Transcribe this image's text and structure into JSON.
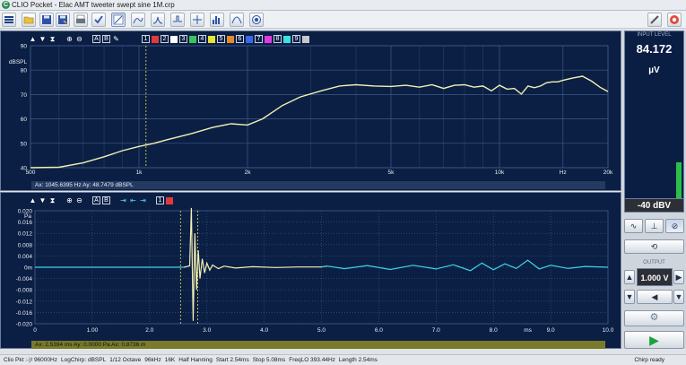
{
  "window": {
    "app_icon_letter": "C",
    "title": "CLIO Pocket - Elac AMT tweeter swept sine 1M.crp"
  },
  "toolbar": {
    "icons": [
      "menu-icon",
      "open-icon",
      "save-icon",
      "save-as-icon",
      "print-icon",
      "checkmark-icon",
      "frequency-response-icon",
      "waterfall-icon",
      "impedance-icon",
      "impulse-icon",
      "spectrum-icon",
      "thd-icon",
      "polar-icon",
      "ruler-icon",
      "help-lifebuoy-icon"
    ]
  },
  "colors": {
    "plot_bg": "#0b1f44",
    "grid": "#3f5a86",
    "grid_minor": "#24406b",
    "curve": "#f2f0b4",
    "impulse_tail": "#3fd3e6",
    "cursor": "#e7e34a",
    "axis_text": "#e8edf5"
  },
  "top_panel": {
    "toolbar": {
      "up": "▲",
      "down": "▼",
      "hourglass": "⧗",
      "zoom_in": "⊕",
      "zoom_out": "⊖",
      "btn_a": "A",
      "btn_b": "B",
      "overlays": [
        "1",
        "2",
        "3",
        "4",
        "5",
        "6",
        "7",
        "8",
        "9"
      ]
    },
    "overlay_colors": [
      "#e23a3a",
      "#ffffff",
      "#3ac45a",
      "#e8e23a",
      "#e88a2a",
      "#3a6ae8",
      "#e23ae2",
      "#3ae2e2",
      "#c8c8c8"
    ],
    "readout": "Ax: 1045.6395 Hz   Ay: 48.7479 dBSPL"
  },
  "bottom_panel": {
    "toolbar": {
      "up": "▲",
      "down": "▼",
      "hourglass": "⧗",
      "zoom_in": "⊕",
      "zoom_out": "⊖",
      "btn_a": "A",
      "btn_b": "B",
      "marker_1": "⇥",
      "marker_2": "⇤",
      "marker_3": "⇥",
      "overlays": [
        "1"
      ]
    },
    "readout": "Ax: 2.5394 ms   Ay: 0.0000 Pa   Ax: 0.8736 m"
  },
  "chart_data": [
    {
      "type": "line",
      "ylabel": "dBSPL",
      "xlabel": "Hz",
      "x_scale": "log",
      "xlim": [
        500,
        20000
      ],
      "ylim": [
        40,
        90
      ],
      "x_tick_labels": [
        "500",
        "1k",
        "2k",
        "5k",
        "10k",
        "Hz",
        "20k"
      ],
      "x_tick_values": [
        500,
        1000,
        2000,
        5000,
        10000,
        15000,
        20000
      ],
      "y_ticks": [
        40,
        50,
        60,
        70,
        80,
        90
      ],
      "cursor_x": 1045.6,
      "grid": true,
      "series": [
        {
          "x": [
            500,
            600,
            700,
            800,
            900,
            1000,
            1100,
            1200,
            1400,
            1600,
            1800,
            2000,
            2200,
            2500,
            2800,
            3200,
            3600,
            4000,
            4500,
            5000,
            5500,
            6000,
            6500,
            7000,
            7500,
            8000,
            8500,
            9000,
            9500,
            10000,
            10500,
            11000,
            11500,
            12000,
            12500,
            13000,
            13500,
            14000,
            14500,
            15000,
            16000,
            17000,
            18000,
            19000,
            20000
          ],
          "y": [
            40,
            40.2,
            42,
            44.5,
            47,
            48.7,
            50,
            51.5,
            54,
            56.5,
            58,
            57.5,
            60,
            65.5,
            69,
            71.5,
            73.5,
            74,
            73.5,
            73.3,
            73.8,
            73,
            74,
            72.5,
            73.8,
            74,
            73,
            73.5,
            71.5,
            73.8,
            72.2,
            72.5,
            70.2,
            73.5,
            72.8,
            73.5,
            74.8,
            75.2,
            75.2,
            75.8,
            76.8,
            77.5,
            75.5,
            73,
            71.2
          ]
        }
      ]
    },
    {
      "type": "line",
      "ylabel": "Pa",
      "xlabel": "ms",
      "xlim": [
        0,
        10
      ],
      "ylim": [
        -0.02,
        0.02
      ],
      "x_tick_labels": [
        "0",
        "1.00",
        "2.0",
        "3.0",
        "4.0",
        "5.0",
        "6.0",
        "7.0",
        "8.0",
        "9.0",
        "10.0"
      ],
      "x_tick_values": [
        0,
        1,
        2,
        3,
        4,
        5,
        6,
        7,
        8,
        9,
        10
      ],
      "y_tick_labels": [
        "0.020",
        "0.016",
        "0.012",
        "0.008",
        "0.004",
        "0m",
        "-0.004",
        "-0.008",
        "-0.012",
        "-0.016",
        "-0.020"
      ],
      "y_tick_values": [
        0.02,
        0.016,
        0.012,
        0.008,
        0.004,
        0,
        -0.004,
        -0.008,
        -0.012,
        -0.016,
        -0.02
      ],
      "cursor_x": [
        2.54,
        2.84
      ],
      "window_marks_ms": [
        2.54,
        5.08
      ],
      "grid": true,
      "series": [
        {
          "x": [
            0,
            2.6,
            2.7,
            2.73,
            2.76,
            2.79,
            2.82,
            2.85,
            2.88,
            2.92,
            2.96,
            3.0,
            3.05,
            3.1,
            3.2,
            3.3,
            3.5,
            3.8,
            4.2,
            4.6,
            5.0,
            5.1,
            5.4,
            5.8,
            6.2,
            6.6,
            7.0,
            7.3,
            7.6,
            7.8,
            8.0,
            8.2,
            8.4,
            8.6,
            8.8,
            9.0,
            9.3,
            9.6,
            10.0
          ],
          "y": [
            0,
            0,
            0.0005,
            0.021,
            -0.019,
            0.012,
            -0.008,
            0.006,
            -0.004,
            0.003,
            -0.002,
            0.0015,
            -0.001,
            0.0008,
            -0.0005,
            0.0004,
            -0.0003,
            0.0002,
            -0.0001,
            0.0001,
            0.0001,
            0.0004,
            -0.0005,
            0.0006,
            -0.0008,
            0.0007,
            -0.0006,
            0.0009,
            -0.0012,
            0.0015,
            -0.0009,
            0.0012,
            -0.0004,
            0.0025,
            -0.0006,
            0.0007,
            -0.0004,
            0.0003,
            0
          ]
        }
      ]
    }
  ],
  "side": {
    "input_title": "INPUT LEVEL",
    "input_value": "84.172",
    "input_unit": "µV",
    "input_level_fraction": 0.27,
    "input_dbv": "-40 dBV",
    "mode_buttons": [
      "∿",
      "⊥",
      "⊘"
    ],
    "loop_button": "⟲",
    "output_title": "OUTPUT",
    "output_value": "1.000 V",
    "up_arrow": "▲",
    "down_arrow": "▼",
    "left_arrow": "◀",
    "right_arrow": "▶",
    "speaker": "◀",
    "settings": "⚙",
    "play": "▶"
  },
  "status": {
    "items": [
      "Clio Pkt :-)! 96000Hz",
      "LogChirp: dBSPL",
      "1/12 Octave",
      "96kHz",
      "16K",
      "Half Hanning",
      "Start 2.54ms",
      "Stop 5.08ms",
      "FreqLO 393.44Hz",
      "Length 2.54ms"
    ],
    "ready": "Chirp ready"
  }
}
